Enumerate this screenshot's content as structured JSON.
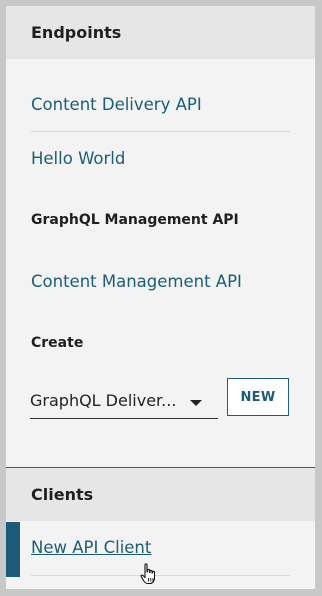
{
  "sidebar": {
    "endpoints_title": "Endpoints",
    "endpoints": [
      {
        "label": "Content Delivery API"
      },
      {
        "label": "Hello World"
      }
    ],
    "management_subtitle": "GraphQL Management API",
    "management_endpoints": [
      {
        "label": "Content Management API"
      }
    ],
    "create_subtitle": "Create",
    "create_select": {
      "value": "GraphQL Deliver..."
    },
    "new_button_label": "NEW",
    "clients_title": "Clients",
    "clients": [
      {
        "label": "New API Client",
        "active": true
      }
    ]
  },
  "colors": {
    "accent": "#1b5d78",
    "panel_bg": "#f3f3f3",
    "header_bg": "#e6e6e6"
  },
  "icons": {
    "cursor": "hand-pointer-icon",
    "dropdown": "caret-down-icon"
  }
}
